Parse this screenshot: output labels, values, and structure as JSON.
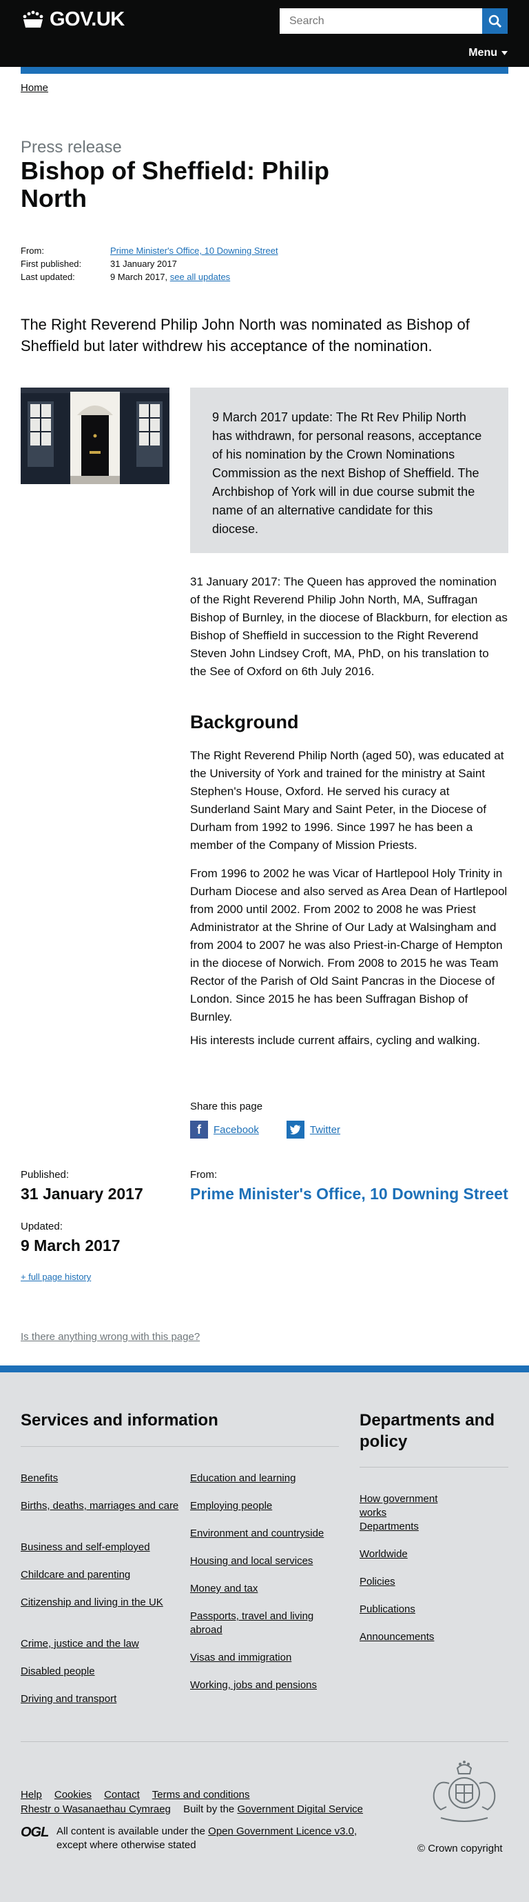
{
  "header": {
    "logo_text": "GOV.UK",
    "search_placeholder": "Search",
    "menu_label": "Menu"
  },
  "breadcrumb": {
    "home": "Home"
  },
  "page": {
    "caption": "Press release",
    "title": "Bishop of Sheffield: Philip North"
  },
  "metadata": {
    "from_label": "From:",
    "from_value": "Prime Minister's Office, 10 Downing Street",
    "first_published_label": "First published:",
    "first_published_value": "31 January 2017",
    "last_updated_label": "Last updated:",
    "last_updated_value": "9 March 2017,",
    "see_all_updates": "see all updates"
  },
  "lead": "The Right Reverend Philip John North was nominated as Bishop of Sheffield but later withdrew his acceptance of the nomination.",
  "callout": "9 March 2017 update: The Rt Rev Philip North has withdrawn, for personal reasons, acceptance of his nomination by the Crown Nominations Commission as the next Bishop of Sheffield. The Archbishop of York will in due course submit the name of an alternative candidate for this diocese.",
  "body": {
    "p1": "31 January 2017: The Queen has approved the nomination of the Right Reverend Philip John North, MA, Suffragan Bishop of Burnley, in the diocese of Blackburn, for election as Bishop of Sheffield in succession to the Right Reverend Steven John Lindsey Croft, MA, PhD, on his translation to the See of Oxford on 6th July 2016.",
    "heading": "Background",
    "p2": "The Right Reverend Philip North (aged 50), was educated at the University of York and trained for the ministry at Saint Stephen's House, Oxford. He served his curacy at Sunderland Saint Mary and Saint Peter, in the Diocese of Durham from 1992 to 1996. Since 1997 he has been a member of the Company of Mission Priests.",
    "p3": "From 1996 to 2002 he was Vicar of Hartlepool Holy Trinity in Durham Diocese and also served as Area Dean of Hartlepool from 2000 until 2002. From 2002 to 2008 he was Priest Administrator at the Shrine of Our Lady at Walsingham and from 2004 to 2007 he was also Priest-in-Charge of Hempton in the diocese of Norwich. From 2008 to 2015 he was Team Rector of the Parish of Old Saint Pancras in the Diocese of London. Since 2015 he has been Suffragan Bishop of Burnley.",
    "p4": "His interests include current affairs, cycling and walking."
  },
  "share": {
    "title": "Share this page",
    "facebook": "Facebook",
    "twitter": "Twitter"
  },
  "published_block": {
    "published_label": "Published:",
    "published_value": "31 January 2017",
    "updated_label": "Updated:",
    "updated_value": "9 March 2017",
    "history_link": "+ full page history",
    "from_label": "From:",
    "from_value": "Prime Minister's Office, 10 Downing Street"
  },
  "report_link": "Is there anything wrong with this page?",
  "footer": {
    "services_heading": "Services and information",
    "services_col1": [
      "Benefits",
      "Births, deaths, marriages and care",
      "Business and self-employed",
      "Childcare and parenting",
      "Citizenship and living in the UK",
      "Crime, justice and the law",
      "Disabled people",
      "Driving and transport"
    ],
    "services_col2": [
      "Education and learning",
      "Employing people",
      "Environment and countryside",
      "Housing and local services",
      "Money and tax",
      "Passports, travel and living abroad",
      "Visas and immigration",
      "Working, jobs and pensions"
    ],
    "departments_heading": "Departments and policy",
    "departments": [
      "How government works",
      "Departments",
      "Worldwide",
      "Policies",
      "Publications",
      "Announcements"
    ],
    "meta_links": [
      "Help",
      "Cookies",
      "Contact",
      "Terms and conditions"
    ],
    "welsh_link": "Rhestr o Wasanaethau Cymraeg",
    "built_by_text": "Built by the",
    "built_by_link": "Government Digital Service",
    "ogl_logo": "OGL",
    "licence_prefix": "All content is available under the",
    "licence_link": "Open Government Licence v3.0",
    "licence_suffix": ", except where otherwise stated",
    "copyright": "© Crown copyright"
  }
}
